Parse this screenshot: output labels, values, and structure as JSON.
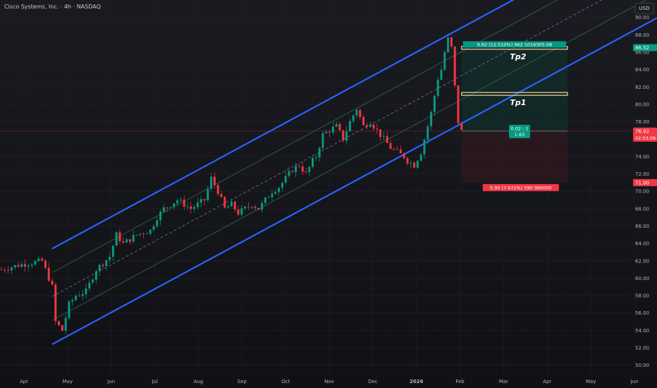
{
  "header": {
    "title": "Cisco Systems, Inc. · 4h · NASDAQ",
    "currency": "USD"
  },
  "chart_data": {
    "type": "candlestick",
    "y_ticks": [
      50,
      52,
      54,
      56,
      58,
      60,
      62,
      64,
      66,
      68,
      70,
      72,
      74,
      76,
      78,
      80,
      82,
      84,
      86,
      88,
      90
    ],
    "ylim": [
      49,
      92
    ],
    "x_ticks": [
      "Apr",
      "May",
      "Jun",
      "Jul",
      "Aug",
      "Sep",
      "Oct",
      "Nov",
      "Dec",
      "2026",
      "Feb",
      "Mar",
      "Apr",
      "May",
      "Jun"
    ],
    "price_path": [
      [
        0,
        61.0
      ],
      [
        5,
        61.5
      ],
      [
        12,
        62.0
      ],
      [
        15,
        59.0
      ],
      [
        16,
        55.0
      ],
      [
        18,
        54.0
      ],
      [
        20,
        57.0
      ],
      [
        22,
        58.0
      ],
      [
        25,
        58.5
      ],
      [
        28,
        61.0
      ],
      [
        32,
        62.5
      ],
      [
        34,
        65.0
      ],
      [
        36,
        64.0
      ],
      [
        40,
        65.0
      ],
      [
        44,
        65.5
      ],
      [
        46,
        67.0
      ],
      [
        48,
        68.0
      ],
      [
        50,
        68.5
      ],
      [
        52,
        69.0
      ],
      [
        54,
        68.5
      ],
      [
        56,
        68.0
      ],
      [
        58,
        68.5
      ],
      [
        60,
        69.0
      ],
      [
        62,
        71.5
      ],
      [
        64,
        70.0
      ],
      [
        66,
        68.0
      ],
      [
        68,
        68.5
      ],
      [
        70,
        67.5
      ],
      [
        72,
        68.0
      ],
      [
        74,
        68.5
      ],
      [
        76,
        68.0
      ],
      [
        78,
        69.0
      ],
      [
        80,
        70.0
      ],
      [
        82,
        70.5
      ],
      [
        84,
        71.5
      ],
      [
        86,
        72.5
      ],
      [
        88,
        73.0
      ],
      [
        90,
        72.0
      ],
      [
        92,
        73.5
      ],
      [
        93,
        74.0
      ],
      [
        95,
        76.5
      ],
      [
        97,
        77.0
      ],
      [
        99,
        77.5
      ],
      [
        101,
        76.0
      ],
      [
        103,
        78.0
      ],
      [
        105,
        79.5
      ],
      [
        107,
        77.5
      ],
      [
        109,
        78.0
      ],
      [
        111,
        77.0
      ],
      [
        113,
        76.0
      ],
      [
        115,
        75.0
      ],
      [
        117,
        74.5
      ],
      [
        119,
        74.0
      ],
      [
        120,
        73.5
      ],
      [
        122,
        73.0
      ],
      [
        124,
        74.5
      ],
      [
        125,
        76.0
      ],
      [
        126,
        77.5
      ],
      [
        127,
        79.0
      ],
      [
        128,
        81.0
      ],
      [
        129,
        83.0
      ],
      [
        130,
        84.0
      ],
      [
        131,
        86.0
      ],
      [
        132,
        87.5
      ],
      [
        133,
        86.5
      ],
      [
        134,
        82.0
      ],
      [
        135,
        78.0
      ],
      [
        136,
        76.9
      ]
    ],
    "current_price": {
      "value": 76.92,
      "label": "76.92",
      "countdown": "02:03:09",
      "color": "#f23645"
    },
    "take_profit_price": {
      "value": 86.52,
      "label": "86.52",
      "color": "#089981"
    },
    "stop_price": {
      "value": 71.0,
      "label": "71.00",
      "color": "#f23645"
    },
    "position": {
      "entry": 76.92,
      "target": 86.52,
      "stop": 71.0,
      "target_label": "9.62 (12.510%) 962 1016305.08",
      "stop_label": "5.90 (7.672%) 590 990000",
      "ratio_label_1": "0.02 : 1",
      "ratio_label_2": "1.63"
    },
    "horizontal_levels": [
      {
        "name": "Tp2",
        "value": 86.5
      },
      {
        "name": "Tp1",
        "value": 81.2
      }
    ],
    "channel": {
      "start_index": 15,
      "upper_start": 63.4,
      "lower_start": 52.4,
      "slope_per_bar": 0.21,
      "color": "#2962ff"
    }
  }
}
